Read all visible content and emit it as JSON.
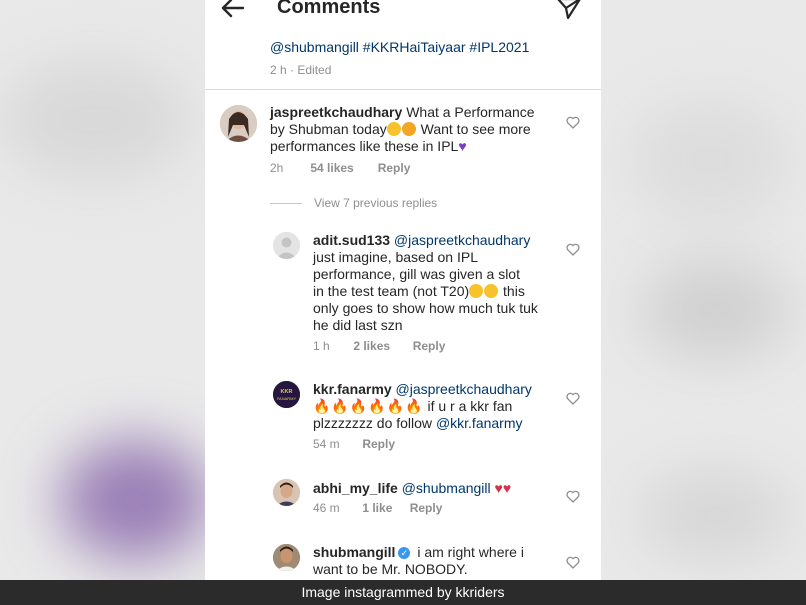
{
  "header": {
    "title": "Comments"
  },
  "caption": {
    "text": "@shubmangill #KKRHaiTaiyaar #IPL2021",
    "time": "2 h",
    "edited": "Edited"
  },
  "comments": [
    {
      "username": "jaspreetkchaudhary",
      "text_line1": "What a Performance",
      "text_line2": "by Shubman today",
      "text_line2b": "Want to see more",
      "text_line3": "performances like these in IPL",
      "time": "2h",
      "likes": "54 likes",
      "reply": "Reply"
    },
    {
      "view_previous": "View 7 previous replies"
    },
    {
      "username": "adit.sud133",
      "mention": "@jaspreetkchaudhary",
      "text_line1": "just imagine, based on IPL",
      "text_line2": "performance, gill was given a slot",
      "text_line3": "in the test team (not T20)",
      "text_line3b": "this",
      "text_line4": "only goes to show how much tuk tuk",
      "text_line5": "he did last szn",
      "time": "1 h",
      "likes": "2 likes",
      "reply": "Reply"
    },
    {
      "username": "kkr.fanarmy",
      "mention": "@jaspreetkchaudhary",
      "text_line2": "if u r a kkr fan",
      "text_line3": "plzzzzzzz do follow",
      "text_line3_mention": "@kkr.fanarmy",
      "time": "54 m",
      "reply": "Reply",
      "avatar_text": "KKR FANARMY"
    },
    {
      "username": "abhi_my_life",
      "mention": "@shubmangill",
      "time": "46 m",
      "likes": "1 like",
      "reply": "Reply"
    },
    {
      "username": "shubmangill",
      "text_line1": "i am right where i",
      "text_line2": "want to be Mr. NOBODY.",
      "verified": true
    }
  ],
  "credit": "Image instagrammed by kkriders",
  "colors": {
    "mention": "#00376b",
    "meta": "#8e8e8e",
    "text": "#262626",
    "verified": "#3897f0"
  }
}
